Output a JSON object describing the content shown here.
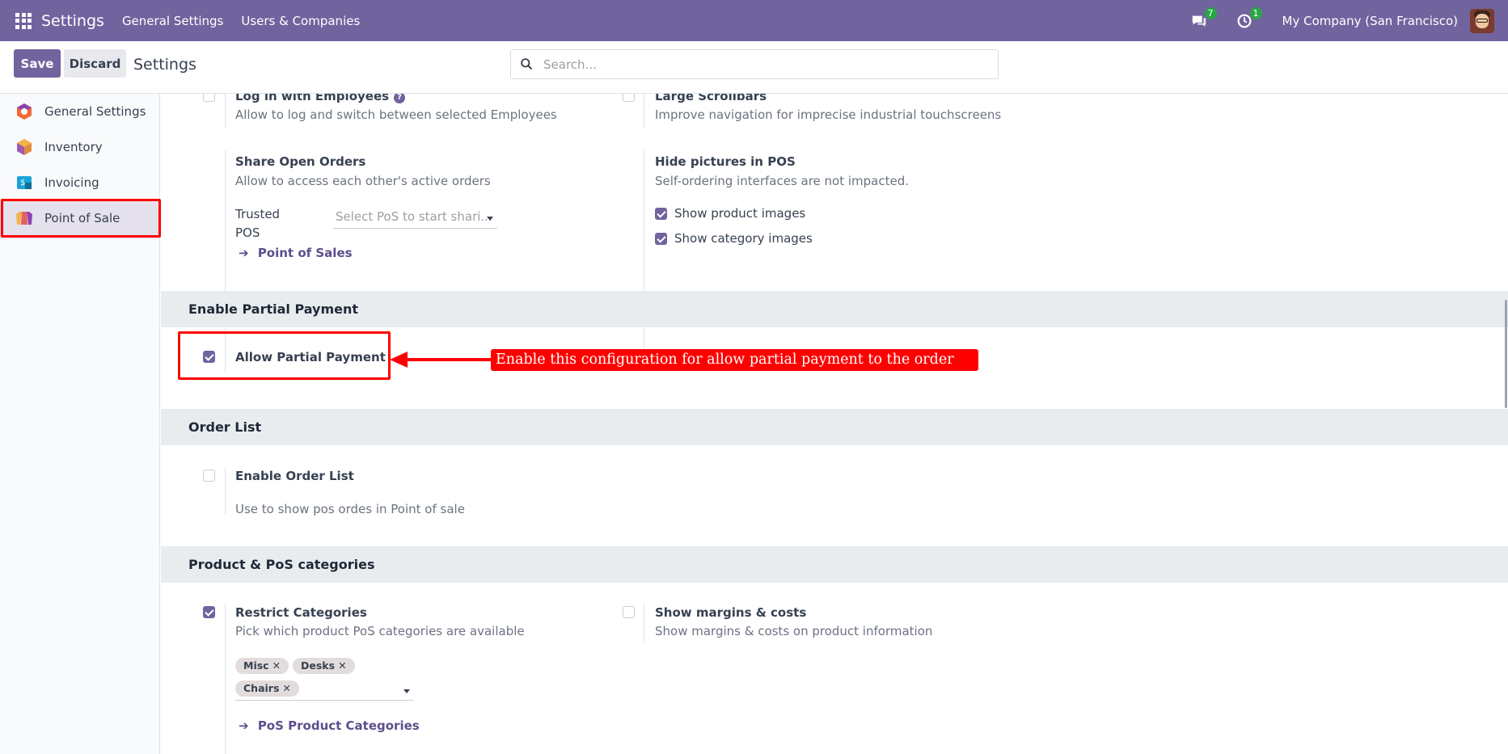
{
  "navbar": {
    "brand": "Settings",
    "menus": [
      "General Settings",
      "Users & Companies"
    ],
    "messages_count": "7",
    "activities_count": "1",
    "company": "My Company (San Francisco)"
  },
  "controlbar": {
    "save_label": "Save",
    "discard_label": "Discard",
    "title": "Settings",
    "search_placeholder": "Search..."
  },
  "sidebar": {
    "items": [
      {
        "label": "General Settings",
        "icon": "odoo-settings-icon"
      },
      {
        "label": "Inventory",
        "icon": "inventory-icon"
      },
      {
        "label": "Invoicing",
        "icon": "invoicing-icon"
      },
      {
        "label": "Point of Sale",
        "icon": "point-of-sale-icon",
        "active": true
      }
    ]
  },
  "content": {
    "login_employees": {
      "title": "Log in with Employees",
      "desc": "Allow to log and switch between selected Employees",
      "checked": false
    },
    "large_scrollbars": {
      "title": "Large Scrollbars",
      "desc": "Improve navigation for imprecise industrial touchscreens",
      "checked": false
    },
    "share_orders": {
      "title": "Share Open Orders",
      "desc": "Allow to access each other's active orders",
      "trusted_label_1": "Trusted",
      "trusted_label_2": "POS",
      "trusted_placeholder": "Select PoS to start shari...",
      "link": "Point of Sales"
    },
    "hide_pictures": {
      "title": "Hide pictures in POS",
      "desc": "Self-ordering interfaces are not impacted.",
      "opt1": "Show product images",
      "opt2": "Show category images"
    },
    "partial_payment": {
      "section": "Enable Partial Payment",
      "title": "Allow Partial Payment",
      "checked": true,
      "annotation": "Enable this configuration for allow partial payment to the order"
    },
    "order_list": {
      "section": "Order List",
      "title": "Enable Order List",
      "desc": "Use to show pos ordes in Point of sale",
      "checked": false
    },
    "product_categories": {
      "section": "Product & PoS categories",
      "restrict_title": "Restrict Categories",
      "restrict_desc": "Pick which product PoS categories are available",
      "tags": [
        "Misc",
        "Desks",
        "Chairs"
      ],
      "link": "PoS Product Categories",
      "margins_title": "Show margins & costs",
      "margins_desc": "Show margins & costs on product information"
    }
  },
  "colors": {
    "brand": "#71639e",
    "annotation": "#ff0000",
    "badge": "#28a745"
  }
}
